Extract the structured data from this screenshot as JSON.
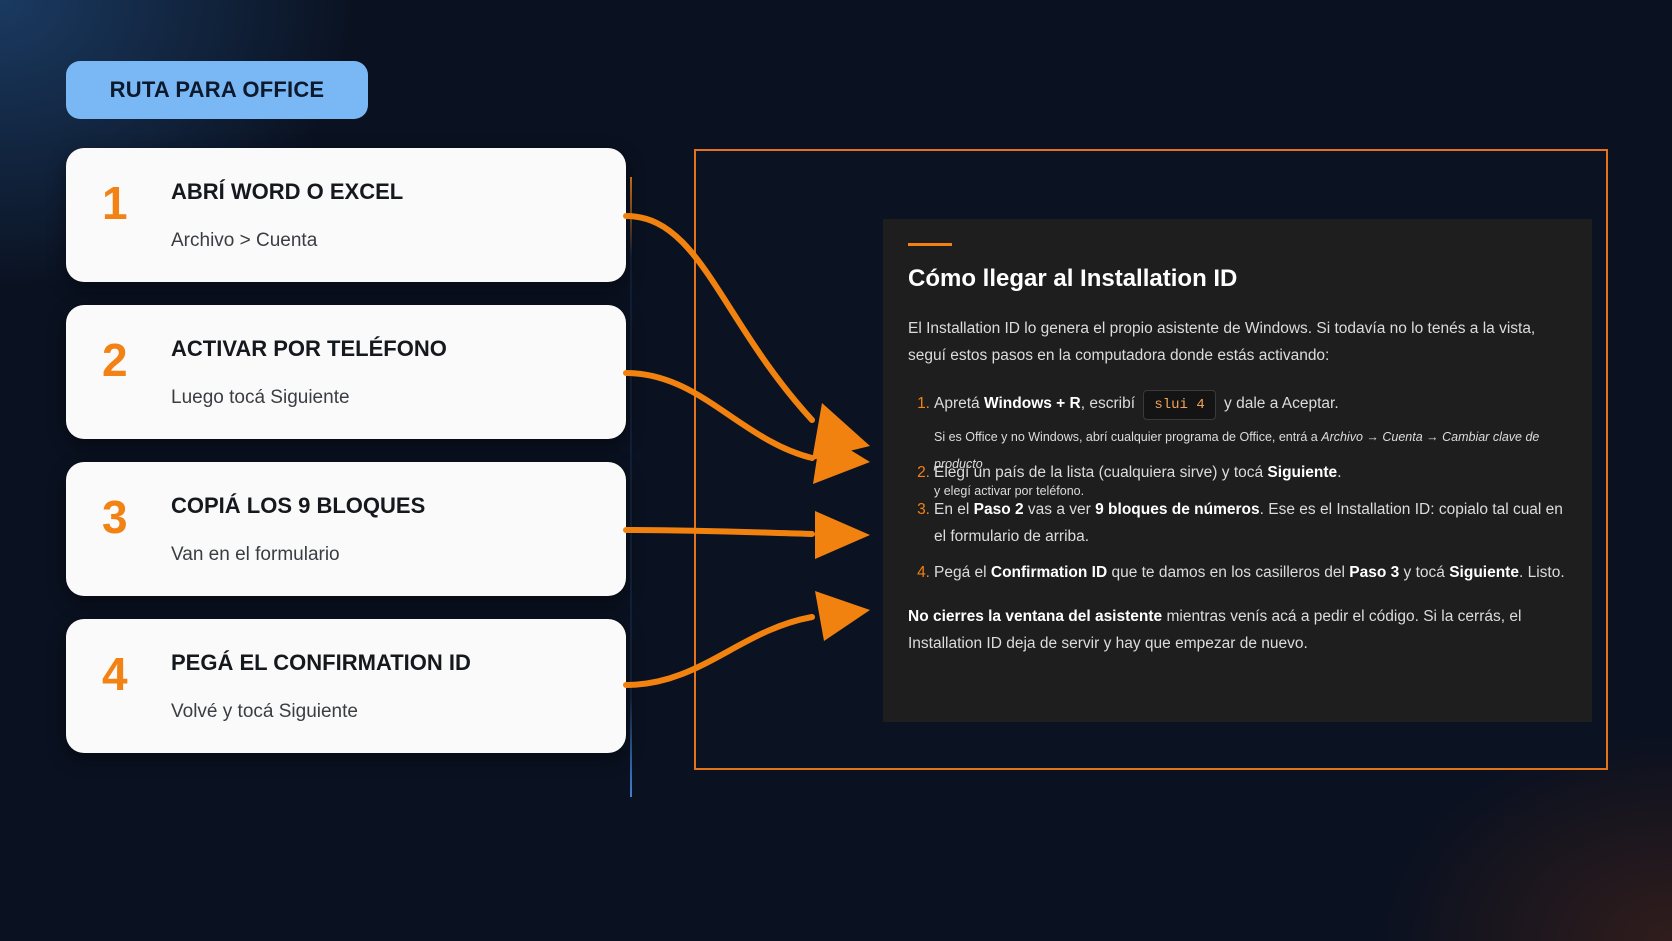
{
  "badge": {
    "label": "RUTA PARA OFFICE"
  },
  "steps": [
    {
      "num": "1",
      "title": "ABRÍ WORD O EXCEL",
      "sub": "Archivo > Cuenta"
    },
    {
      "num": "2",
      "title": "ACTIVAR POR TELÉFONO",
      "sub": "Luego tocá Siguiente"
    },
    {
      "num": "3",
      "title": "COPIÁ LOS 9 BLOQUES",
      "sub": "Van en el formulario"
    },
    {
      "num": "4",
      "title": "PEGÁ EL CONFIRMATION ID",
      "sub": "Volvé y tocá Siguiente"
    }
  ],
  "panel": {
    "title": "Cómo llegar al Installation ID",
    "intro": "El Installation ID lo genera el propio asistente de Windows. Si todavía no lo tenés a la vista, seguí estos pasos en la computadora donde estás activando:",
    "items": [
      {
        "n": "1.",
        "p1": "Apretá ",
        "b1": "Windows + R",
        "p2": ", escribí",
        "code": "slui 4",
        "p3": "y dale a Aceptar.",
        "note_pre": "Si es Office y no Windows, abrí cualquier programa de Office, entrá a ",
        "note_path": "Archivo → Cuenta → Cambiar clave de producto",
        "note_post": "y elegí activar por teléfono."
      },
      {
        "n": "2.",
        "p1": "Elegí un país de la lista (cualquiera sirve) y tocá ",
        "b1": "Siguiente",
        "p2": "."
      },
      {
        "n": "3.",
        "p1": "En el ",
        "b1": "Paso 2",
        "p2": " vas a ver ",
        "b2": "9 bloques de números",
        "p3": ". Ese es el Installation ID: copialo tal cual en el formulario de arriba."
      },
      {
        "n": "4.",
        "p1": "Pegá el ",
        "b1": "Confirmation ID",
        "p2": " que te damos en los casilleros del ",
        "b2": "Paso 3",
        "p3": " y tocá ",
        "b3": "Siguiente",
        "p4": ". Listo."
      }
    ],
    "warning_bold": "No cierres la ventana del asistente",
    "warning_rest": " mientras venís acá a pedir el código. Si la cerrás, el Installation ID deja de servir y hay que empezar de nuevo."
  },
  "colors": {
    "accent": "#f28213",
    "badge": "#7ab8f5",
    "card": "#fafafa",
    "panel": "#1e1e1e",
    "background": "#0a1120"
  },
  "icons": [
    "arrow-icon"
  ]
}
